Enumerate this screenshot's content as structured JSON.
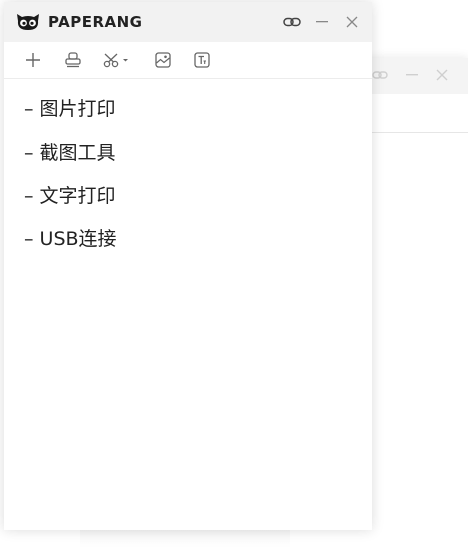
{
  "app": {
    "title": "PAPERANG"
  },
  "toolbar": {
    "tools": [
      {
        "name": "add",
        "icon": "plus-icon"
      },
      {
        "name": "print",
        "icon": "stamp-icon"
      },
      {
        "name": "cut",
        "icon": "scissors-icon"
      },
      {
        "name": "image",
        "icon": "image-icon"
      },
      {
        "name": "text",
        "icon": "text-box-icon"
      }
    ]
  },
  "window_controls": {
    "link": "link-icon",
    "minimize": "minimize-icon",
    "close": "close-icon"
  },
  "note": {
    "items": [
      {
        "text": "– 图片打印"
      },
      {
        "text": "– 截图工具"
      },
      {
        "text": "– 文字打印"
      },
      {
        "text": "– USB连接"
      }
    ]
  },
  "colors": {
    "titlebar": "#f2f2f2",
    "text": "#222222",
    "icon": "#666666"
  }
}
